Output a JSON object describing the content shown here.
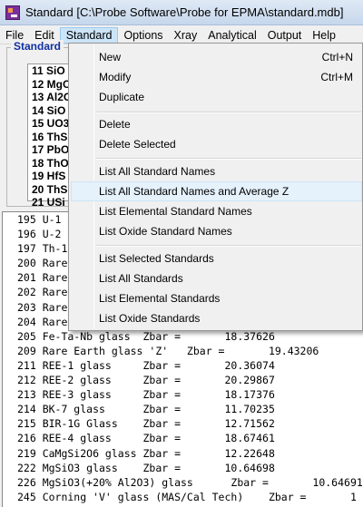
{
  "window": {
    "title": "Standard [C:\\Probe Software\\Probe for EPMA\\standard.mdb]",
    "icon": "probe-app-icon"
  },
  "menubar": {
    "items": [
      "File",
      "Edit",
      "Standard",
      "Options",
      "Xray",
      "Analytical",
      "Output",
      "Help"
    ],
    "active": "Standard"
  },
  "standards_group": {
    "label": "Standard",
    "items": [
      "11 SiO",
      "12 MgO",
      "13 Al2O",
      "14 SiO",
      "15 UO3",
      "16 ThS",
      "17 PbO",
      "18 ThO",
      "19 HfS",
      "20 ThS",
      "21 USi"
    ]
  },
  "dropdown": {
    "items": [
      {
        "label": "New",
        "shortcut": "Ctrl+N"
      },
      {
        "label": "Modify",
        "shortcut": "Ctrl+M"
      },
      {
        "label": "Duplicate",
        "shortcut": ""
      },
      {
        "label": "Delete",
        "shortcut": ""
      },
      {
        "label": "Delete Selected",
        "shortcut": ""
      },
      {
        "label": "List All Standard Names",
        "shortcut": ""
      },
      {
        "label": "List All Standard Names and Average Z",
        "shortcut": ""
      },
      {
        "label": "List Elemental Standard Names",
        "shortcut": ""
      },
      {
        "label": "List Oxide Standard Names",
        "shortcut": ""
      },
      {
        "label": "List Selected Standards",
        "shortcut": ""
      },
      {
        "label": "List All Standards",
        "shortcut": ""
      },
      {
        "label": "List Elemental Standards",
        "shortcut": ""
      },
      {
        "label": "List Oxide Standards",
        "shortcut": ""
      }
    ],
    "highlighted": "List All Standard Names and Average Z"
  },
  "log": {
    "lines": [
      "195 U-1",
      "196 U-2",
      "197 Th-1",
      "200 Rare",
      "201 Rare",
      "202 Rare",
      "203 Rare",
      "204 Rare",
      "205 Fe-Ta-Nb glass  Zbar =       18.37626",
      "209 Rare Earth glass 'Z'   Zbar =       19.43206",
      "211 REE-1 glass     Zbar =       20.36074",
      "212 REE-2 glass     Zbar =       20.29867",
      "213 REE-3 glass     Zbar =       18.17376",
      "214 BK-7 glass      Zbar =       11.70235",
      "215 BIR-1G Glass    Zbar =       12.71562",
      "216 REE-4 glass     Zbar =       18.67461",
      "219 CaMgSi2O6 glass Zbar =       12.22648",
      "222 MgSiO3 glass    Zbar =       10.64698",
      "226 MgSiO3(+20% Al2O3) glass      Zbar =       10.64691",
      "245 Corning 'V' glass (MAS/Cal Tech)    Zbar =       1"
    ]
  },
  "colors": {
    "menu_highlight": "#cce4f7",
    "group_label": "#1030a0"
  }
}
